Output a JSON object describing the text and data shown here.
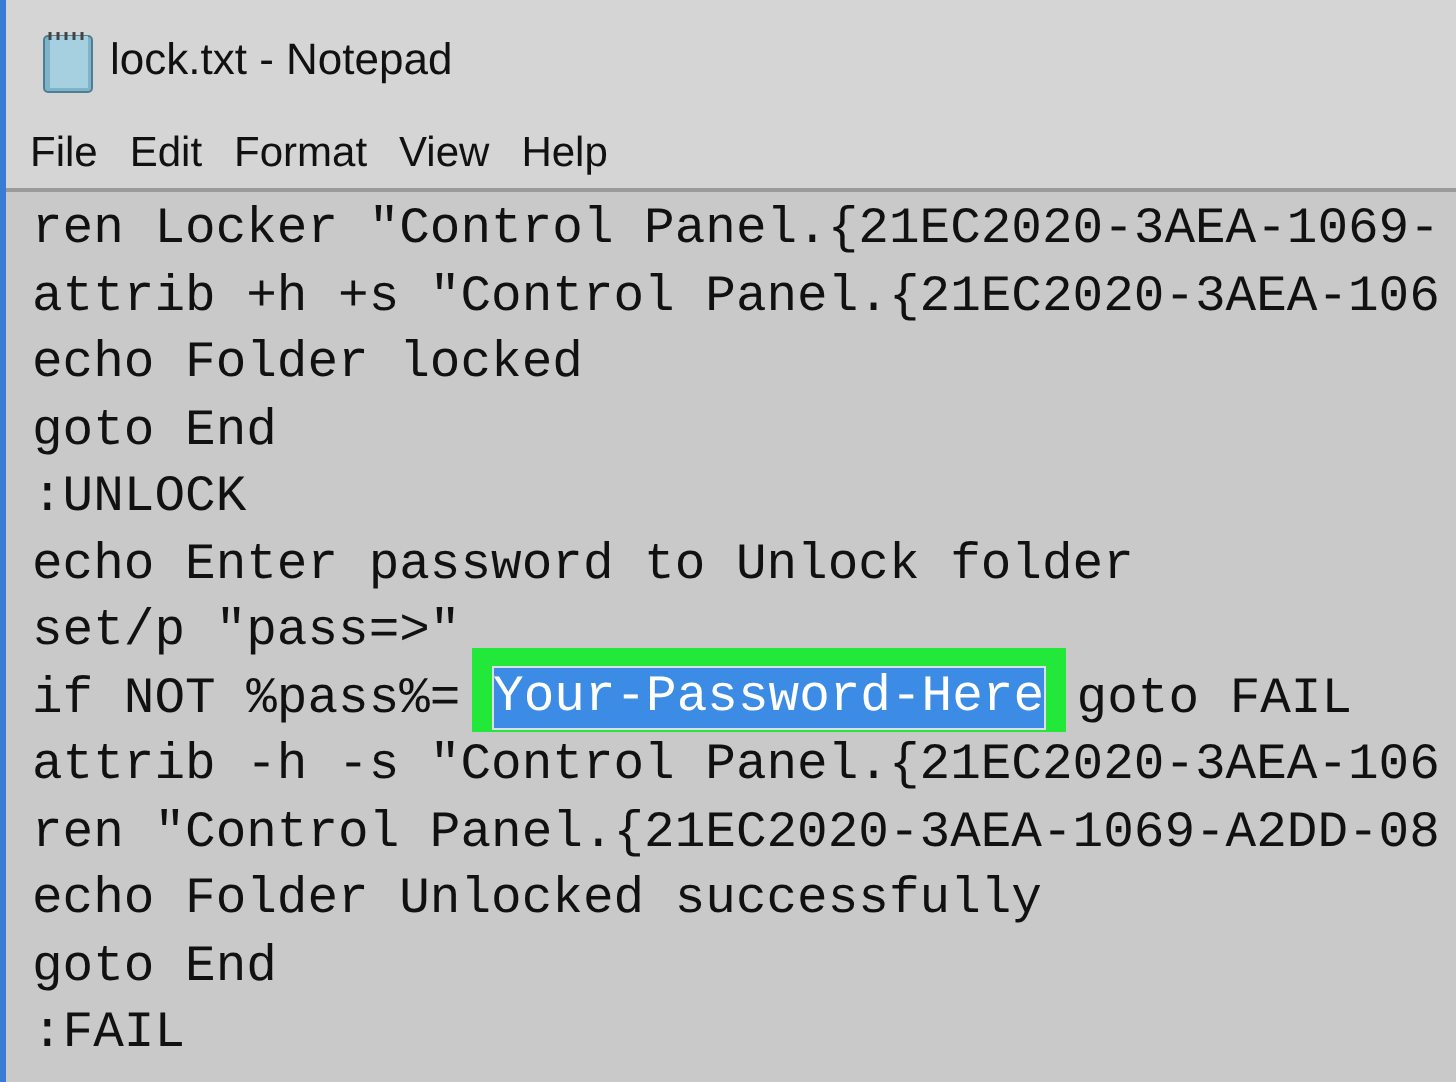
{
  "window": {
    "title": "lock.txt - Notepad"
  },
  "menu": [
    "File",
    "Edit",
    "Format",
    "View",
    "Help"
  ],
  "lines": [
    {
      "segments": [
        {
          "text": "ren Locker \"Control Panel.{21EC2020-3AEA-1069-",
          "selected": false
        }
      ]
    },
    {
      "segments": [
        {
          "text": "attrib +h +s \"Control Panel.{21EC2020-3AEA-106",
          "selected": false
        }
      ]
    },
    {
      "segments": [
        {
          "text": "echo Folder locked",
          "selected": false
        }
      ]
    },
    {
      "segments": [
        {
          "text": "goto End",
          "selected": false
        }
      ]
    },
    {
      "segments": [
        {
          "text": ":UNLOCK",
          "selected": false
        }
      ]
    },
    {
      "segments": [
        {
          "text": "echo Enter password to Unlock folder",
          "selected": false
        }
      ]
    },
    {
      "segments": [
        {
          "text": "set/p \"pass=>\"",
          "selected": false
        }
      ]
    },
    {
      "segments": [
        {
          "text": "if NOT %pass%=",
          "selected": false
        },
        {
          "text": "Your-Password-Here",
          "selected": true
        },
        {
          "text": " goto FAIL",
          "selected": false
        }
      ]
    },
    {
      "segments": [
        {
          "text": "attrib -h -s \"Control Panel.{21EC2020-3AEA-106",
          "selected": false
        }
      ]
    },
    {
      "segments": [
        {
          "text": "ren \"Control Panel.{21EC2020-3AEA-1069-A2DD-08",
          "selected": false
        }
      ]
    },
    {
      "segments": [
        {
          "text": "echo Folder Unlocked successfully",
          "selected": false
        }
      ]
    },
    {
      "segments": [
        {
          "text": "goto End",
          "selected": false
        }
      ]
    },
    {
      "segments": [
        {
          "text": ":FAIL",
          "selected": false
        }
      ]
    }
  ]
}
